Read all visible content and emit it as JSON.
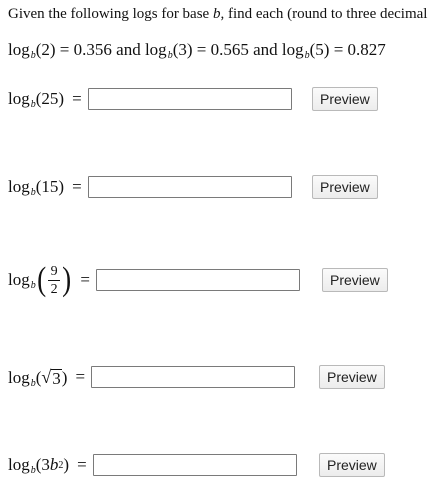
{
  "intro": {
    "prefix": "Given the following logs for base ",
    "variable": "b",
    "suffix": ", find each (round to three decimal"
  },
  "given": {
    "log_fn": "log",
    "base": "b",
    "part1": "(2) = 0.356 and ",
    "part2": "(3) = 0.565 and ",
    "part3": "(5) = 0.827"
  },
  "questions": [
    {
      "log_fn": "log",
      "base": "b",
      "arg": "(25)",
      "equals": "=",
      "answer_value": "",
      "preview_label": "Preview"
    },
    {
      "log_fn": "log",
      "base": "b",
      "arg": "(15)",
      "equals": "=",
      "answer_value": "",
      "preview_label": "Preview"
    },
    {
      "log_fn": "log",
      "base": "b",
      "open_paren": "(",
      "numerator": "9",
      "denominator": "2",
      "close_paren": ")",
      "equals": "=",
      "answer_value": "",
      "preview_label": "Preview"
    },
    {
      "log_fn": "log",
      "base": "b",
      "open_paren": "(",
      "radicand": "3",
      "close_paren": ")",
      "equals": "=",
      "answer_value": "",
      "preview_label": "Preview"
    },
    {
      "log_fn": "log",
      "base": "b",
      "open_paren": "(3",
      "power_base": "b",
      "exponent": "2",
      "close_paren": ")",
      "equals": "=",
      "answer_value": "",
      "preview_label": "Preview"
    }
  ]
}
